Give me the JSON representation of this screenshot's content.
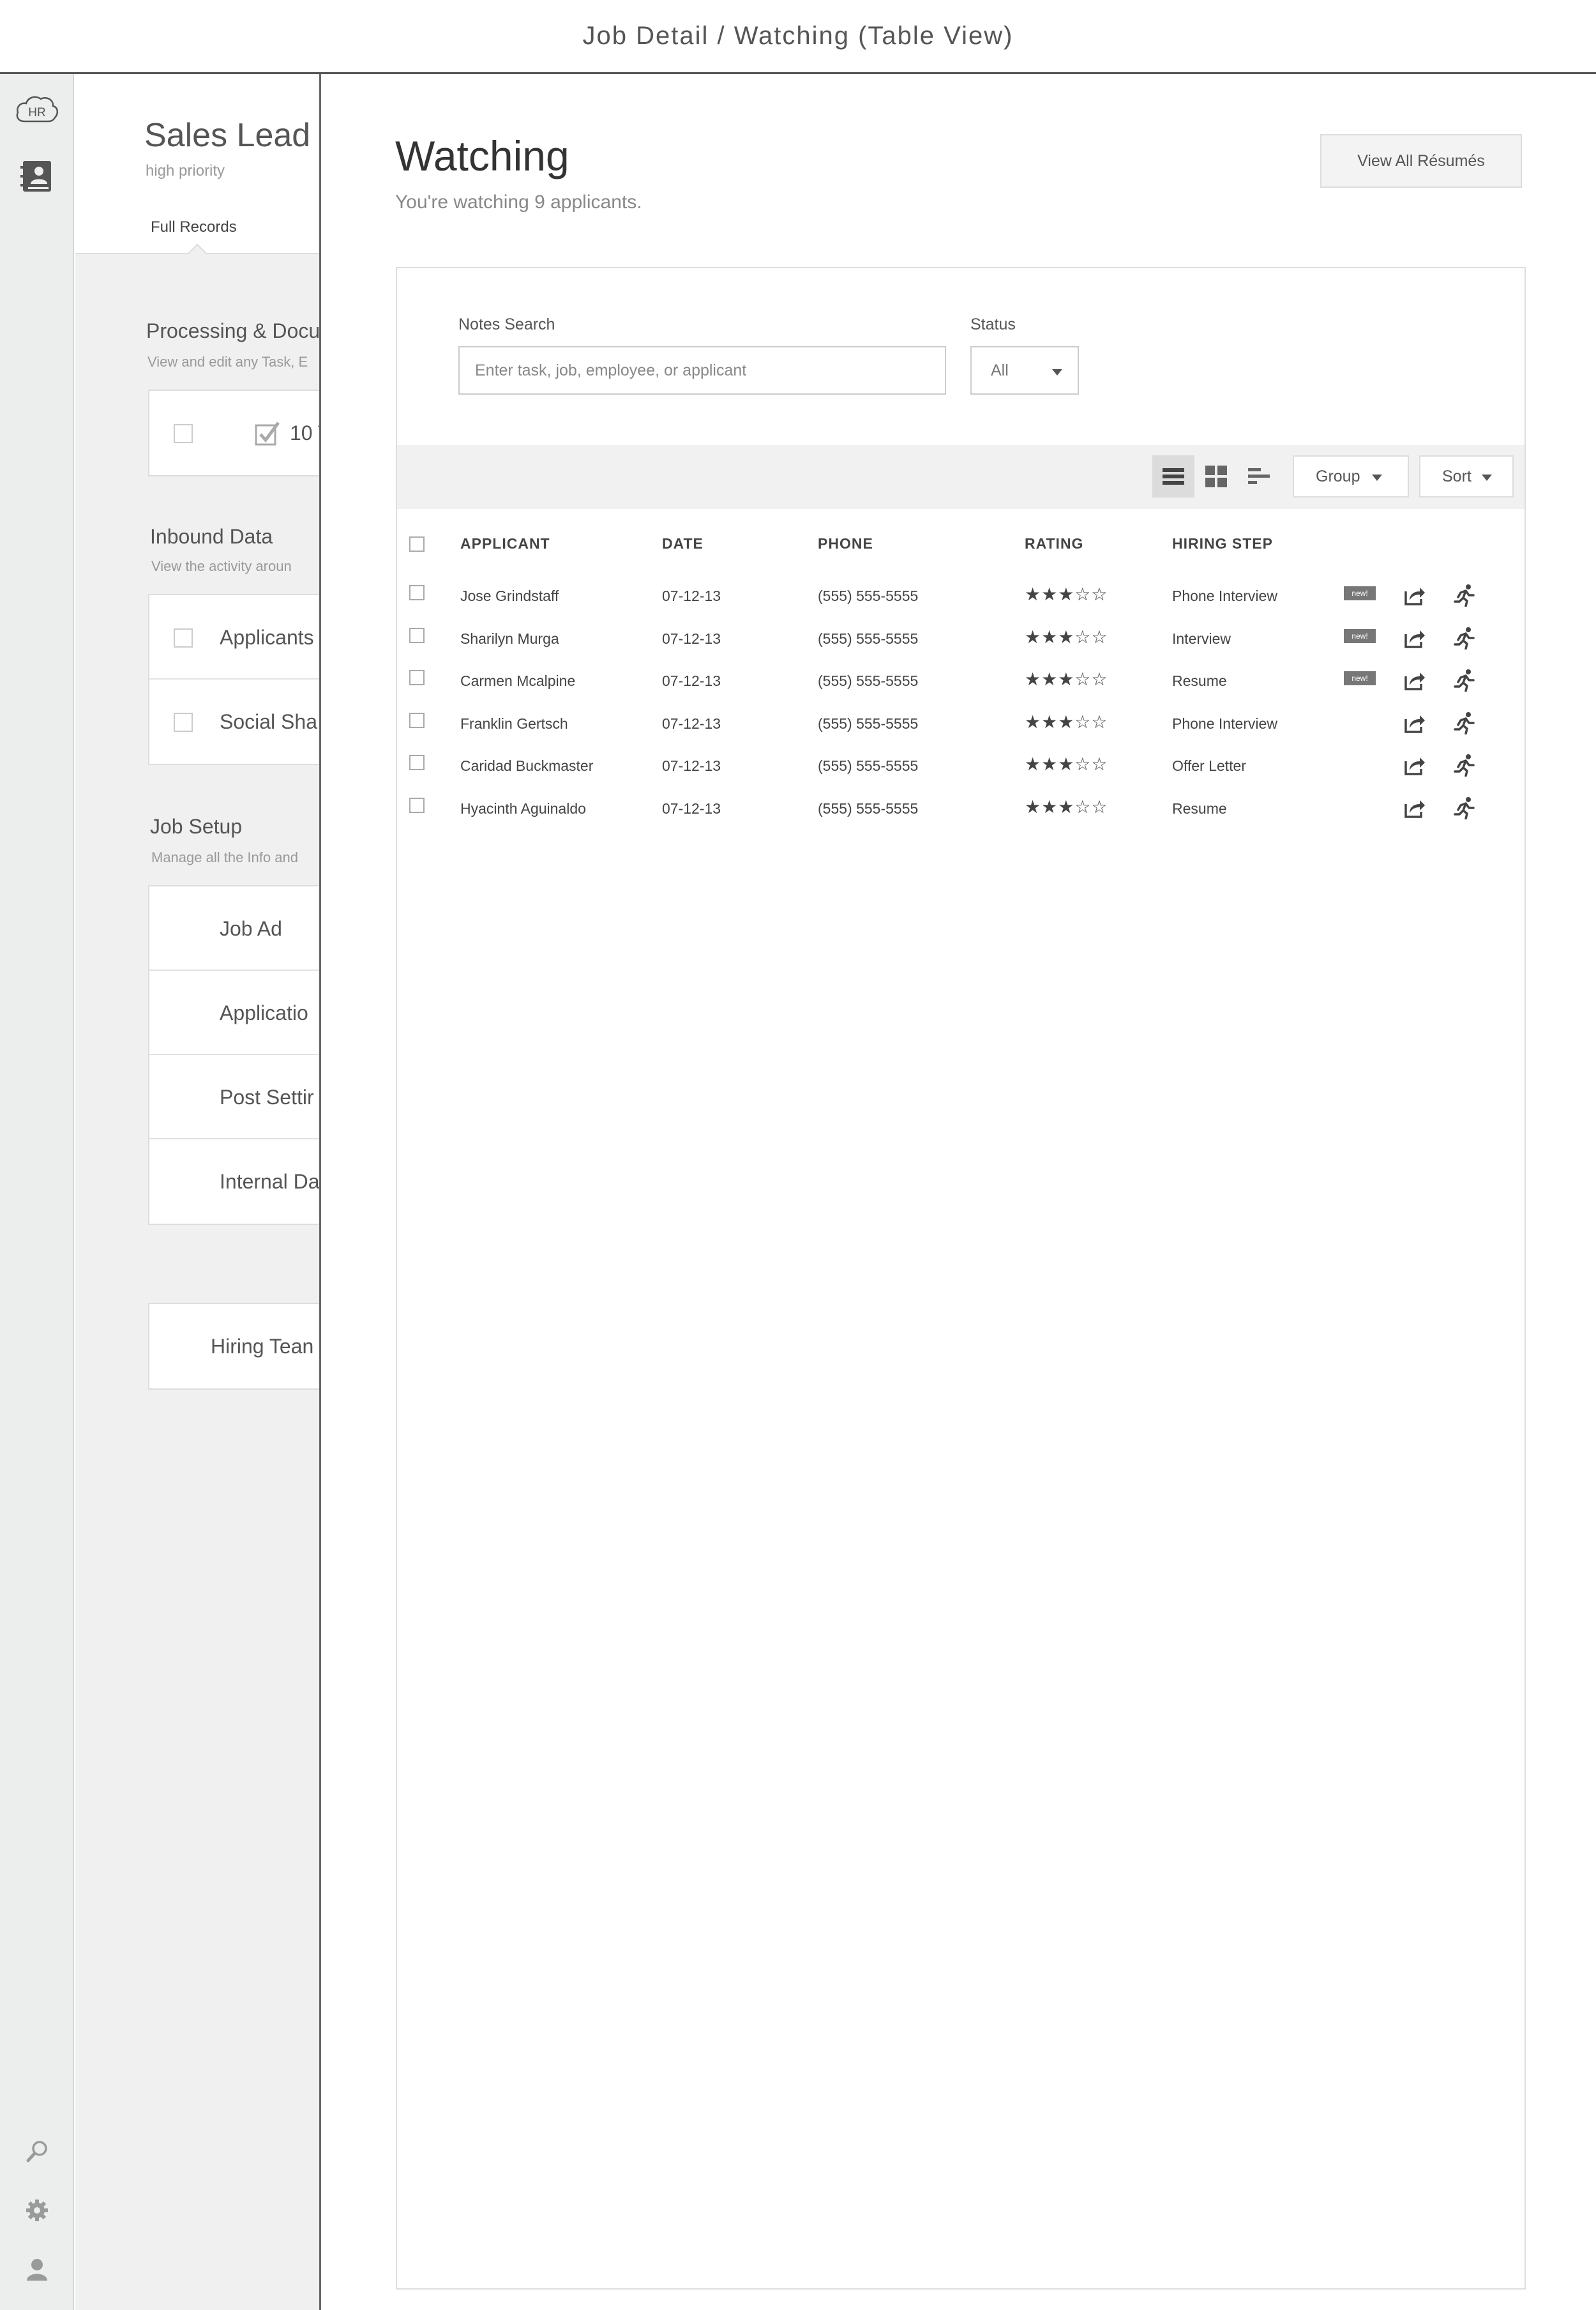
{
  "page_title": "Job Detail / Watching (Table View)",
  "rail": {
    "logo_text": "HR",
    "logo_icon": "cloud-hr-icon",
    "app_icon": "contact-book-icon",
    "bottom_icons": [
      "search-icon",
      "gear-icon",
      "user-icon"
    ]
  },
  "background": {
    "title": "Sales Lead",
    "subtitle": "high priority",
    "tab_label": "Full Records",
    "sections": [
      {
        "title": "Processing & Docu",
        "desc": "View and edit any Task, E",
        "rows": [
          "10 T"
        ]
      },
      {
        "title": "Inbound Data",
        "desc": "View the activity aroun",
        "rows": [
          "Applicants",
          "Social Sha"
        ]
      },
      {
        "title": "Job Setup",
        "desc": "Manage all the Info and",
        "rows": [
          "Job Ad",
          "Applicatio",
          "Post Settir",
          "Internal Da"
        ]
      }
    ],
    "extra_card": "Hiring Tean"
  },
  "watching": {
    "title": "Watching",
    "subtitle": "You're watching 9 applicants.",
    "view_all_label": "View All Résumés",
    "filters": {
      "notes_label": "Notes Search",
      "notes_placeholder": "Enter task, job, employee, or applicant",
      "status_label": "Status",
      "status_value": "All"
    },
    "toolbar": {
      "view_icons": [
        "list-view-icon",
        "grid-view-icon",
        "timeline-view-icon"
      ],
      "active_view": "list",
      "group_label": "Group",
      "sort_label": "Sort"
    },
    "table": {
      "columns": [
        "APPLICANT",
        "DATE",
        "PHONE",
        "RATING",
        "HIRING STEP"
      ],
      "rows": [
        {
          "name": "Jose Grindstaff",
          "date": "07-12-13",
          "phone": "(555) 555-5555",
          "rating": 3,
          "step": "Phone Interview",
          "badge": "new!"
        },
        {
          "name": "Sharilyn Murga",
          "date": "07-12-13",
          "phone": "(555) 555-5555",
          "rating": 3,
          "step": "Interview",
          "badge": "new!"
        },
        {
          "name": "Carmen Mcalpine",
          "date": "07-12-13",
          "phone": "(555) 555-5555",
          "rating": 3,
          "step": "Resume",
          "badge": "new!"
        },
        {
          "name": "Franklin Gertsch",
          "date": "07-12-13",
          "phone": "(555) 555-5555",
          "rating": 3,
          "step": "Phone Interview",
          "badge": ""
        },
        {
          "name": "Caridad Buckmaster",
          "date": "07-12-13",
          "phone": "(555) 555-5555",
          "rating": 3,
          "step": "Offer Letter",
          "badge": ""
        },
        {
          "name": "Hyacinth Aguinaldo",
          "date": "07-12-13",
          "phone": "(555) 555-5555",
          "rating": 3,
          "step": "Resume",
          "badge": ""
        }
      ],
      "max_rating": 5,
      "row_action_icons": [
        "share-icon",
        "runner-icon"
      ]
    }
  }
}
